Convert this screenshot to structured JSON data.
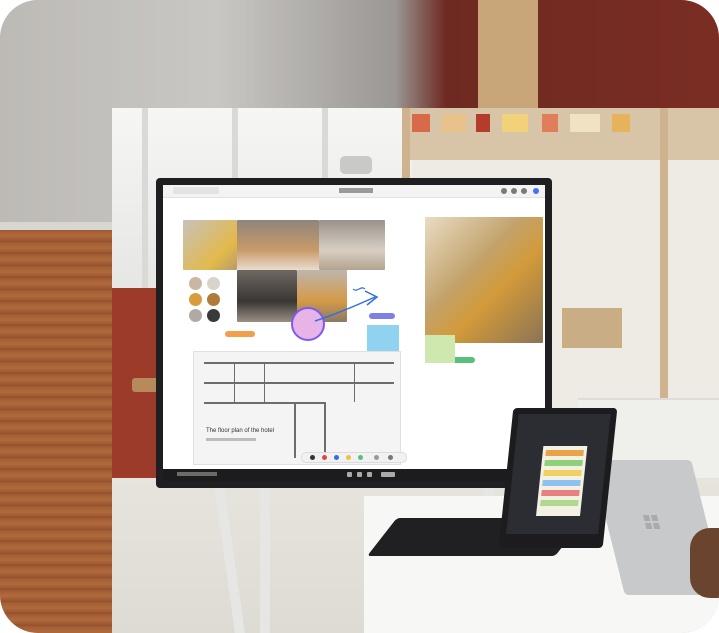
{
  "photo": {
    "subject": "",
    "colors": {
      "wall_red": "#7a2d23",
      "wood": "#a05b32",
      "device_bezel": "#1f1f22",
      "screen": "#ffffff"
    }
  },
  "whiteboard": {
    "plan_caption": "The floor plan of the hotel",
    "swatch_colors": [
      "#c9b7a4",
      "#d8d4cc",
      "#d89c3c",
      "#b07a3a",
      "#3a3a3a",
      "#b0aaa4"
    ],
    "pill_colors": [
      "#f0a04a",
      "#7f7fe8",
      "#58c07a",
      "#e8b3e6"
    ],
    "note_colors": [
      "#8fd3f0",
      "#cfe8b0"
    ]
  }
}
